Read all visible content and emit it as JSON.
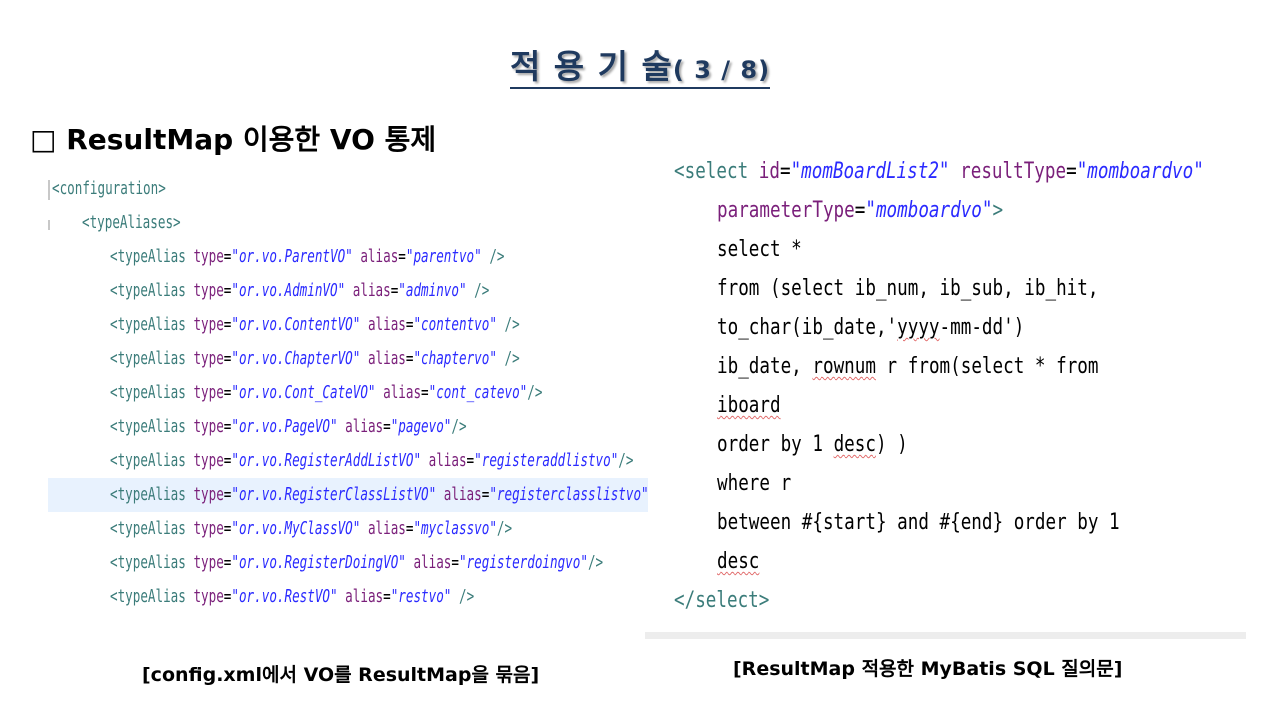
{
  "slide": {
    "title_main": "적 용 기 술",
    "title_num": "( 3 / 8)",
    "section_heading": "□ ResultMap 이용한 VO 통제"
  },
  "xml_code": {
    "lines": [
      {
        "indent": 0,
        "tag": "<configuration>"
      },
      {
        "indent": 1,
        "tag": "<typeAliases>"
      },
      {
        "indent": 2,
        "tag": "<typeAlias",
        "type": "\"or.vo.ParentVO\"",
        "alias": "\"parentvo\"",
        "end": " />"
      },
      {
        "indent": 2,
        "tag": "<typeAlias",
        "type": "\"or.vo.AdminVO\"",
        "alias": "\"adminvo\"",
        "end": " />"
      },
      {
        "indent": 2,
        "tag": "<typeAlias",
        "type": "\"or.vo.ContentVO\"",
        "alias": "\"contentvo\"",
        "end": " />"
      },
      {
        "indent": 2,
        "tag": "<typeAlias",
        "type": "\"or.vo.ChapterVO\"",
        "alias": "\"chaptervo\"",
        "end": " />"
      },
      {
        "indent": 2,
        "tag": "<typeAlias",
        "type": "\"or.vo.Cont_CateVO\"",
        "alias": "\"cont_catevo\"",
        "end": "/>"
      },
      {
        "indent": 2,
        "tag": "<typeAlias",
        "type": "\"or.vo.PageVO\"",
        "alias": "\"pagevo\"",
        "end": "/>"
      },
      {
        "indent": 2,
        "tag": "<typeAlias",
        "type": "\"or.vo.RegisterAddListVO\"",
        "alias": "\"registeraddlistvo\"",
        "end": "/>"
      },
      {
        "indent": 2,
        "tag": "<typeAlias",
        "type": "\"or.vo.RegisterClassListVO\"",
        "alias": "\"registerclasslistvo\"",
        "end": "/>"
      },
      {
        "indent": 2,
        "tag": "<typeAlias",
        "type": "\"or.vo.MyClassVO\"",
        "alias": "\"myclassvo\"",
        "end": "/>"
      },
      {
        "indent": 2,
        "tag": "<typeAlias",
        "type": "\"or.vo.RegisterDoingVO\"",
        "alias": "\"registerdoingvo\"",
        "end": "/>"
      },
      {
        "indent": 2,
        "tag": "<typeAlias",
        "type": "\"or.vo.RestVO\"",
        "alias": "\"restvo\"",
        "end": " />"
      }
    ],
    "attr_type": "type",
    "attr_alias": "alias",
    "highlight_line": 9
  },
  "sql_code": {
    "l1_tag": "<select",
    "l1_id_attr": "id",
    "l1_id_val": "\"momBoardList2\"",
    "l1_rt_attr": "resultType",
    "l1_rt_val": "\"momboardvo\"",
    "l2_pt_attr": "parameterType",
    "l2_pt_val": "\"momboardvo\"",
    "l2_end": ">",
    "l3": "select *",
    "l4": "from (select ib_num, ib_sub, ib_hit,",
    "l5a": "to_char(ib_date,'",
    "l5b": "yyyy",
    "l5c": "-mm-dd')",
    "l6a": "ib_date, ",
    "l6b": "rownum",
    "l6c": " r from(select * from",
    "l7": "iboard",
    "l8a": "order by 1 ",
    "l8b": "desc",
    "l8c": ") )",
    "l9": "where r",
    "l10": "between #{start} and #{end} order by 1",
    "l11": "desc",
    "l12": "</select>"
  },
  "captions": {
    "left": "[config.xml에서 VO를 ResultMap을 묶음]",
    "right": "[ResultMap 적용한 MyBatis SQL 질의문]"
  }
}
